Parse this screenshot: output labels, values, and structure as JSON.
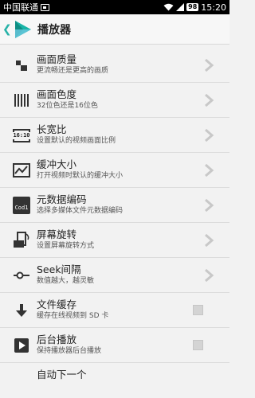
{
  "status": {
    "carrier": "中国联通",
    "battery": "98",
    "time": "15:20"
  },
  "header": {
    "title": "播放器"
  },
  "items": [
    {
      "title": "画面质量",
      "subtitle": "更流畅还是更高的画质",
      "control": "chevron"
    },
    {
      "title": "画面色度",
      "subtitle": "32位色还是16位色",
      "control": "chevron"
    },
    {
      "title": "长宽比",
      "subtitle": "设置默认的视频画面比例",
      "icon_text": "16:10",
      "control": "chevron"
    },
    {
      "title": "缓冲大小",
      "subtitle": "打开视频时默认的缓冲大小",
      "control": "chevron"
    },
    {
      "title": "元数据编码",
      "subtitle": "选择多媒体文件元数据编码",
      "icon_text": "Cod1",
      "control": "chevron"
    },
    {
      "title": "屏幕旋转",
      "subtitle": "设置屏幕旋转方式",
      "control": "chevron"
    },
    {
      "title": "Seek间隔",
      "subtitle": "数值越大，越灵敏",
      "control": "chevron"
    },
    {
      "title": "文件缓存",
      "subtitle": "缓存在线视频到 SD 卡",
      "control": "checkbox",
      "checked": false
    },
    {
      "title": "后台播放",
      "subtitle": "保持播放器后台播放",
      "control": "checkbox",
      "checked": false
    },
    {
      "title": "自动下一个",
      "subtitle": "",
      "control": "checkbox"
    }
  ]
}
